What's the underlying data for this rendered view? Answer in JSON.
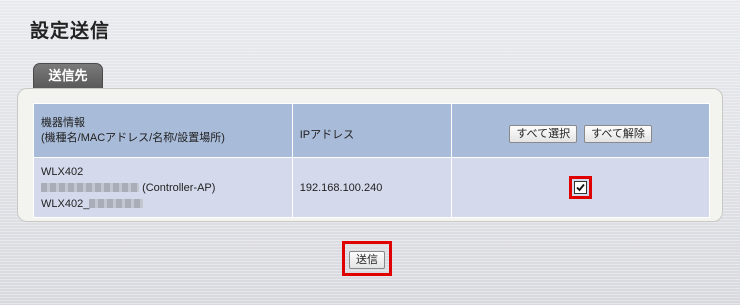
{
  "page": {
    "title": "設定送信"
  },
  "tab": {
    "label": "送信先"
  },
  "table": {
    "headers": {
      "device_info_line1": "機器情報",
      "device_info_line2": "(機種名/MACアドレス/名称/設置場所)",
      "ip": "IPアドレス"
    },
    "select_all_label": "すべて選択",
    "deselect_all_label": "すべて解除",
    "rows": [
      {
        "model": "WLX402",
        "mac_suffix": "(Controller-AP)",
        "name_prefix": "WLX402_",
        "ip": "192.168.100.240",
        "checked": true
      }
    ]
  },
  "submit": {
    "label": "送信"
  },
  "colors": {
    "header_bg": "#a8bbd8",
    "row_bg": "#d4d9ec",
    "highlight": "#e00000",
    "tab_bg": "#5a5a5a"
  }
}
